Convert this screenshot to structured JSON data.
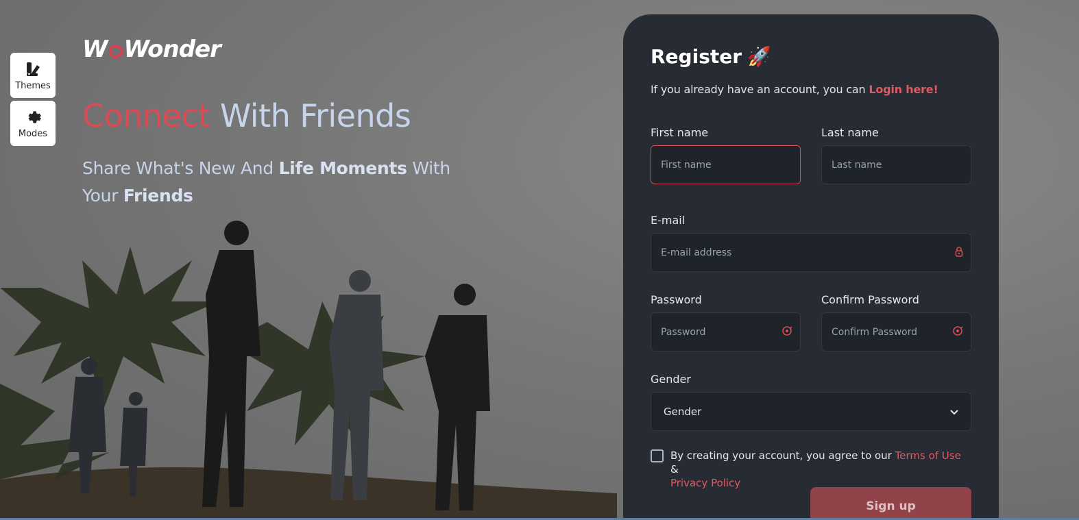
{
  "sidebar": {
    "themes_label": "Themes",
    "modes_label": "Modes"
  },
  "brand": {
    "logo_text_a": "W",
    "logo_text_b": "Wonder"
  },
  "hero": {
    "title_accent": "Connect",
    "title_rest": "With Friends",
    "sub_part1": "Share What's New And ",
    "sub_bold1": "Life Moments",
    "sub_part2": " With Your ",
    "sub_bold2": "Friends"
  },
  "register": {
    "title": "Register",
    "title_emoji": "🚀",
    "login_prefix": "If you already have an account, you can ",
    "login_link": "Login here!",
    "first_name_label": "First name",
    "first_name_placeholder": "First name",
    "last_name_label": "Last name",
    "last_name_placeholder": "Last name",
    "email_label": "E-mail",
    "email_placeholder": "E-mail address",
    "password_label": "Password",
    "password_placeholder": "Password",
    "confirm_label": "Confirm Password",
    "confirm_placeholder": "Confirm Password",
    "gender_label": "Gender",
    "gender_selected": "Gender",
    "terms_prefix": "By creating your account, you agree to our ",
    "terms_link": "Terms of Use",
    "terms_amp": " & ",
    "privacy_link": "Privacy Policy",
    "signup_label": "Sign up"
  },
  "colors": {
    "accent": "#d94b55",
    "card_bg": "#272b33",
    "input_bg": "#1f232a",
    "signup_bg": "#924249"
  }
}
